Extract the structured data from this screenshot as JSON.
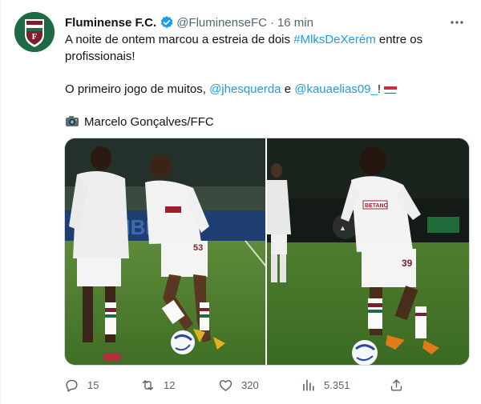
{
  "tweet": {
    "author_name": "Fluminense F.C.",
    "handle": "@FluminenseFC",
    "separator": "·",
    "time": "16 min",
    "line1_text": "A noite de ontem marcou a estreia de dois ",
    "line1_hashtag": "#MlksDeXerém",
    "line1_rest": " entre os profissionais!",
    "line2_text": "O primeiro jogo de muitos, ",
    "mention1": "@jhesquerda",
    "line2_and": " e ",
    "mention2": "@kauaelias09_",
    "line2_end": "!",
    "credit": "Marcelo Gonçalves/FFC"
  },
  "actions": {
    "replies": "15",
    "retweets": "12",
    "likes": "320",
    "views": "5.351"
  },
  "icons": {
    "verified": "verified-badge-icon",
    "more": "more-options-icon",
    "reply": "reply-icon",
    "retweet": "retweet-icon",
    "like": "heart-icon",
    "views": "views-icon",
    "share": "share-icon",
    "camera": "camera-icon",
    "flag": "hungary-flag-icon"
  },
  "colors": {
    "link": "#1d9bf0",
    "muted": "#536471",
    "club_grena": "#7a1f2b",
    "club_green": "#1e6a45"
  }
}
